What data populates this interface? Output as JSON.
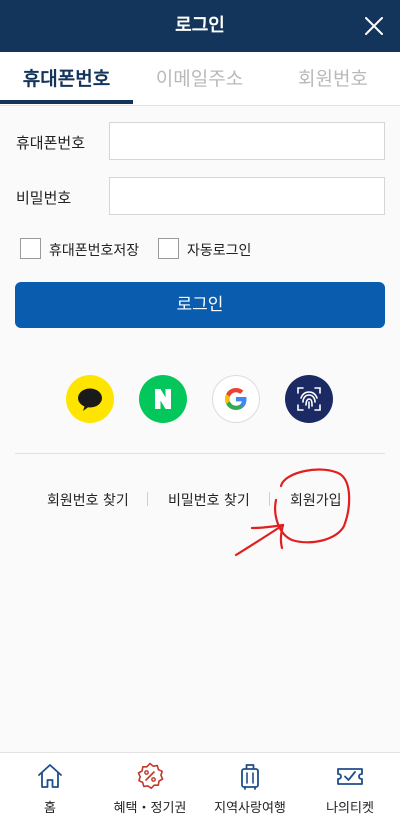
{
  "header": {
    "title": "로그인",
    "close_icon": "close-icon"
  },
  "tabs": [
    {
      "label": "휴대폰번호",
      "active": true
    },
    {
      "label": "이메일주소",
      "active": false
    },
    {
      "label": "회원번호",
      "active": false
    }
  ],
  "form": {
    "phone_label": "휴대폰번호",
    "phone_value": "",
    "password_label": "비밀번호",
    "password_value": "",
    "save_phone_label": "휴대폰번호저장",
    "auto_login_label": "자동로그인"
  },
  "login_button": "로그인",
  "social": [
    {
      "icon": "kakao-icon",
      "color": "#fee500"
    },
    {
      "icon": "naver-icon",
      "color": "#03c75a"
    },
    {
      "icon": "google-icon",
      "color": "#ffffff"
    },
    {
      "icon": "fingerprint-icon",
      "color": "#1c2a63"
    }
  ],
  "links": {
    "find_member_number": "회원번호 찾기",
    "find_password": "비밀번호 찾기",
    "sign_up": "회원가입"
  },
  "bottom_nav": [
    {
      "label": "홈",
      "icon": "home-icon"
    },
    {
      "label": "혜택・정기권",
      "icon": "percent-badge-icon"
    },
    {
      "label": "지역사랑여행",
      "icon": "luggage-icon"
    },
    {
      "label": "나의티켓",
      "icon": "ticket-icon"
    }
  ],
  "colors": {
    "header_bg": "#14355b",
    "primary_button": "#0a5cae",
    "accent_red": "#c0392b",
    "annotation_red": "#e02020"
  }
}
